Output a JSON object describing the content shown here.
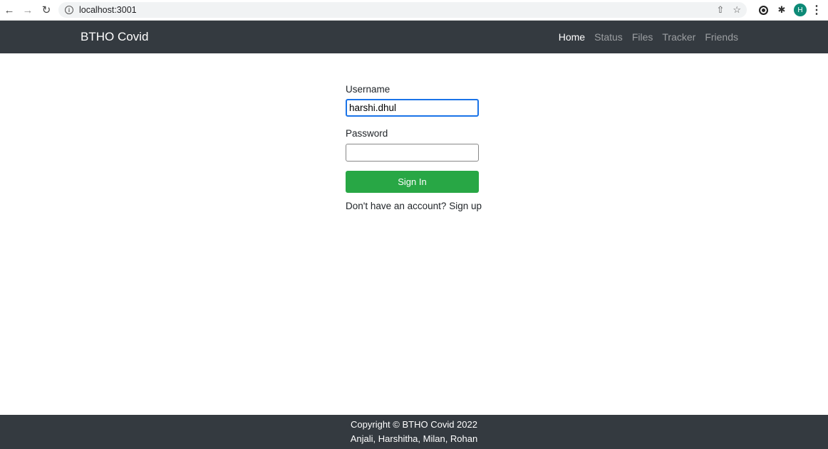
{
  "browser": {
    "url": "localhost:3001",
    "avatar_letter": "H"
  },
  "navbar": {
    "brand": "BTHO Covid",
    "links": [
      {
        "label": "Home",
        "active": true
      },
      {
        "label": "Status",
        "active": false
      },
      {
        "label": "Files",
        "active": false
      },
      {
        "label": "Tracker",
        "active": false
      },
      {
        "label": "Friends",
        "active": false
      }
    ]
  },
  "form": {
    "username_label": "Username",
    "username_value": "harshi.dhul",
    "password_label": "Password",
    "password_value": "",
    "submit_label": "Sign In",
    "signup_prompt": "Don't have an account?",
    "signup_link": "Sign up"
  },
  "footer": {
    "copyright": "Copyright © BTHO Covid 2022",
    "authors": "Anjali, Harshitha, Milan, Rohan"
  },
  "colors": {
    "navbar_bg": "#343a40",
    "button_green": "#28a745",
    "focus_blue": "#1a73e8"
  }
}
